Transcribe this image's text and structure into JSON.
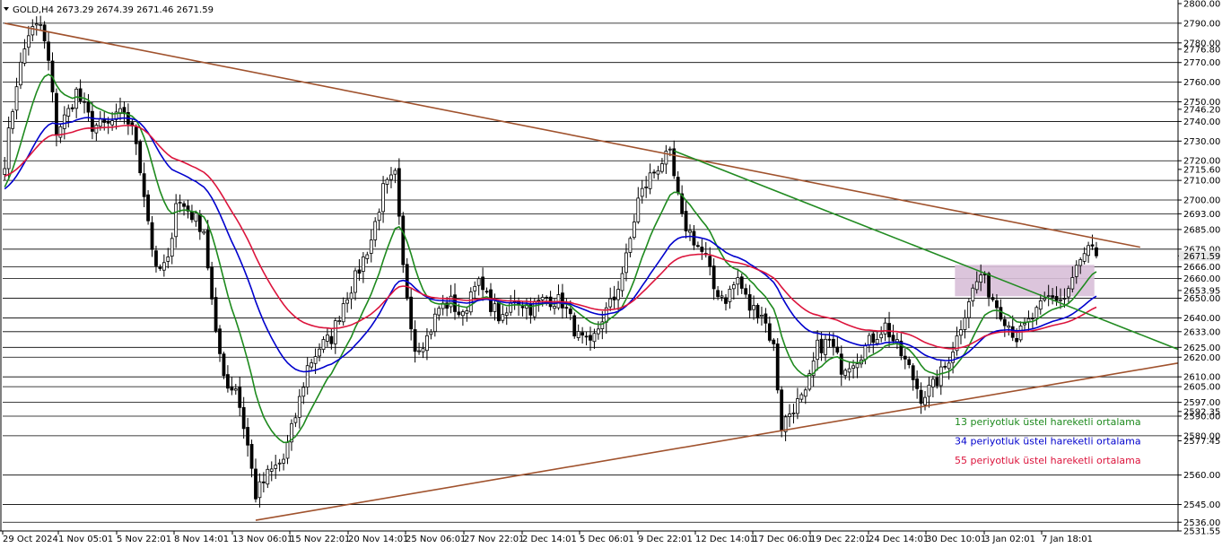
{
  "header": {
    "symbol": "GOLD,H4",
    "ohlc": "2673.29 2674.39 2671.46 2671.59"
  },
  "chart_data": {
    "type": "candlestick",
    "ylim": [
      2531.55,
      2800.0
    ],
    "y_ticks": [
      "2800.00",
      "2790.00",
      "2780.00",
      "2776.80",
      "2770.00",
      "2760.00",
      "2750.00",
      "2746.20",
      "2740.00",
      "2730.00",
      "2720.00",
      "2715.60",
      "2710.00",
      "2700.00",
      "2693.00",
      "2685.00",
      "2675.00",
      "2671.59",
      "2666.00",
      "2660.00",
      "2653.95",
      "2650.00",
      "2640.00",
      "2633.00",
      "2625.00",
      "2620.00",
      "2610.00",
      "2605.00",
      "2597.00",
      "2592.35",
      "2590.00",
      "2580.00",
      "2577.45",
      "2560.00",
      "2545.00",
      "2536.00",
      "2531.55"
    ],
    "hlines": [
      2790,
      2780,
      2770,
      2760,
      2750,
      2740,
      2730,
      2720,
      2710,
      2700,
      2693,
      2685,
      2675,
      2666,
      2660,
      2650,
      2640,
      2633,
      2625,
      2620,
      2610,
      2605,
      2597,
      2590,
      2580,
      2560,
      2545,
      2536
    ],
    "x_ticks": [
      "29 Oct 2024",
      "1 Nov 05:01",
      "5 Nov 22:01",
      "8 Nov 14:01",
      "13 Nov 06:01",
      "15 Nov 22:01",
      "20 Nov 14:01",
      "25 Nov 06:01",
      "27 Nov 22:01",
      "2 Dec 14:01",
      "5 Dec 06:01",
      "9 Dec 22:01",
      "12 Dec 14:01",
      "17 Dec 06:01",
      "19 Dec 22:01",
      "24 Dec 14:01",
      "30 Dec 10:01",
      "3 Jan 02:01",
      "7 Jan 18:01"
    ],
    "close_price": 2671.59,
    "trendlines": [
      {
        "name": "descending-resistance",
        "color": "#a0522d",
        "from": {
          "i": 0,
          "p": 2790
        },
        "to": {
          "i": 285,
          "p": 2676
        }
      },
      {
        "name": "ascending-support",
        "color": "#a0522d",
        "from": {
          "i": 63,
          "p": 2537
        },
        "to": {
          "i": 295,
          "p": 2617
        }
      },
      {
        "name": "breakout-line",
        "color": "#228b22",
        "from": {
          "i": 168,
          "p": 2725
        },
        "to": {
          "i": 295,
          "p": 2624
        }
      }
    ],
    "zone": {
      "i0": 239,
      "i1": 274,
      "top": 2667,
      "bottom": 2651,
      "color": "#d8bfd8"
    },
    "candle_count": 295,
    "anchors": [
      [
        0,
        2720
      ],
      [
        3,
        2760
      ],
      [
        6,
        2785
      ],
      [
        9,
        2789
      ],
      [
        11,
        2770
      ],
      [
        13,
        2735
      ],
      [
        16,
        2745
      ],
      [
        18,
        2755
      ],
      [
        22,
        2738
      ],
      [
        26,
        2738
      ],
      [
        30,
        2745
      ],
      [
        33,
        2730
      ],
      [
        36,
        2690
      ],
      [
        38,
        2663
      ],
      [
        41,
        2668
      ],
      [
        43,
        2700
      ],
      [
        46,
        2695
      ],
      [
        50,
        2685
      ],
      [
        53,
        2630
      ],
      [
        56,
        2605
      ],
      [
        58,
        2605
      ],
      [
        61,
        2575
      ],
      [
        63,
        2550
      ],
      [
        66,
        2560
      ],
      [
        70,
        2568
      ],
      [
        73,
        2590
      ],
      [
        76,
        2615
      ],
      [
        79,
        2625
      ],
      [
        82,
        2630
      ],
      [
        85,
        2648
      ],
      [
        88,
        2660
      ],
      [
        92,
        2680
      ],
      [
        95,
        2705
      ],
      [
        98,
        2712
      ],
      [
        100,
        2665
      ],
      [
        103,
        2625
      ],
      [
        106,
        2630
      ],
      [
        109,
        2645
      ],
      [
        112,
        2648
      ],
      [
        115,
        2640
      ],
      [
        118,
        2660
      ],
      [
        121,
        2650
      ],
      [
        125,
        2638
      ],
      [
        128,
        2650
      ],
      [
        132,
        2645
      ],
      [
        136,
        2650
      ],
      [
        140,
        2648
      ],
      [
        144,
        2630
      ],
      [
        147,
        2625
      ],
      [
        150,
        2640
      ],
      [
        153,
        2650
      ],
      [
        156,
        2670
      ],
      [
        159,
        2700
      ],
      [
        162,
        2712
      ],
      [
        165,
        2720
      ],
      [
        167,
        2722
      ],
      [
        170,
        2690
      ],
      [
        173,
        2680
      ],
      [
        176,
        2670
      ],
      [
        178,
        2655
      ],
      [
        181,
        2650
      ],
      [
        184,
        2660
      ],
      [
        187,
        2645
      ],
      [
        190,
        2643
      ],
      [
        193,
        2625
      ],
      [
        195,
        2585
      ],
      [
        198,
        2595
      ],
      [
        201,
        2600
      ],
      [
        204,
        2625
      ],
      [
        207,
        2628
      ],
      [
        210,
        2615
      ],
      [
        214,
        2620
      ],
      [
        218,
        2630
      ],
      [
        221,
        2636
      ],
      [
        224,
        2625
      ],
      [
        227,
        2614
      ],
      [
        230,
        2600
      ],
      [
        233,
        2605
      ],
      [
        236,
        2615
      ],
      [
        239,
        2630
      ],
      [
        242,
        2650
      ],
      [
        245,
        2662
      ],
      [
        248,
        2650
      ],
      [
        251,
        2640
      ],
      [
        254,
        2630
      ],
      [
        258,
        2640
      ],
      [
        262,
        2650
      ],
      [
        266,
        2650
      ],
      [
        269,
        2665
      ],
      [
        272,
        2675
      ],
      [
        274,
        2672
      ]
    ],
    "series": [
      {
        "name": "13 periyotluk üstel hareketli ortalama",
        "color": "#1e8a1e",
        "period": 13
      },
      {
        "name": "34 periyotluk üstel hareketli ortalama",
        "color": "#0000cd",
        "period": 34
      },
      {
        "name": "55 periyotluk üstel hareketli ortalama",
        "color": "#dc143c",
        "period": 55
      }
    ],
    "ema_seed": [
      2705,
      2705,
      2712
    ]
  }
}
